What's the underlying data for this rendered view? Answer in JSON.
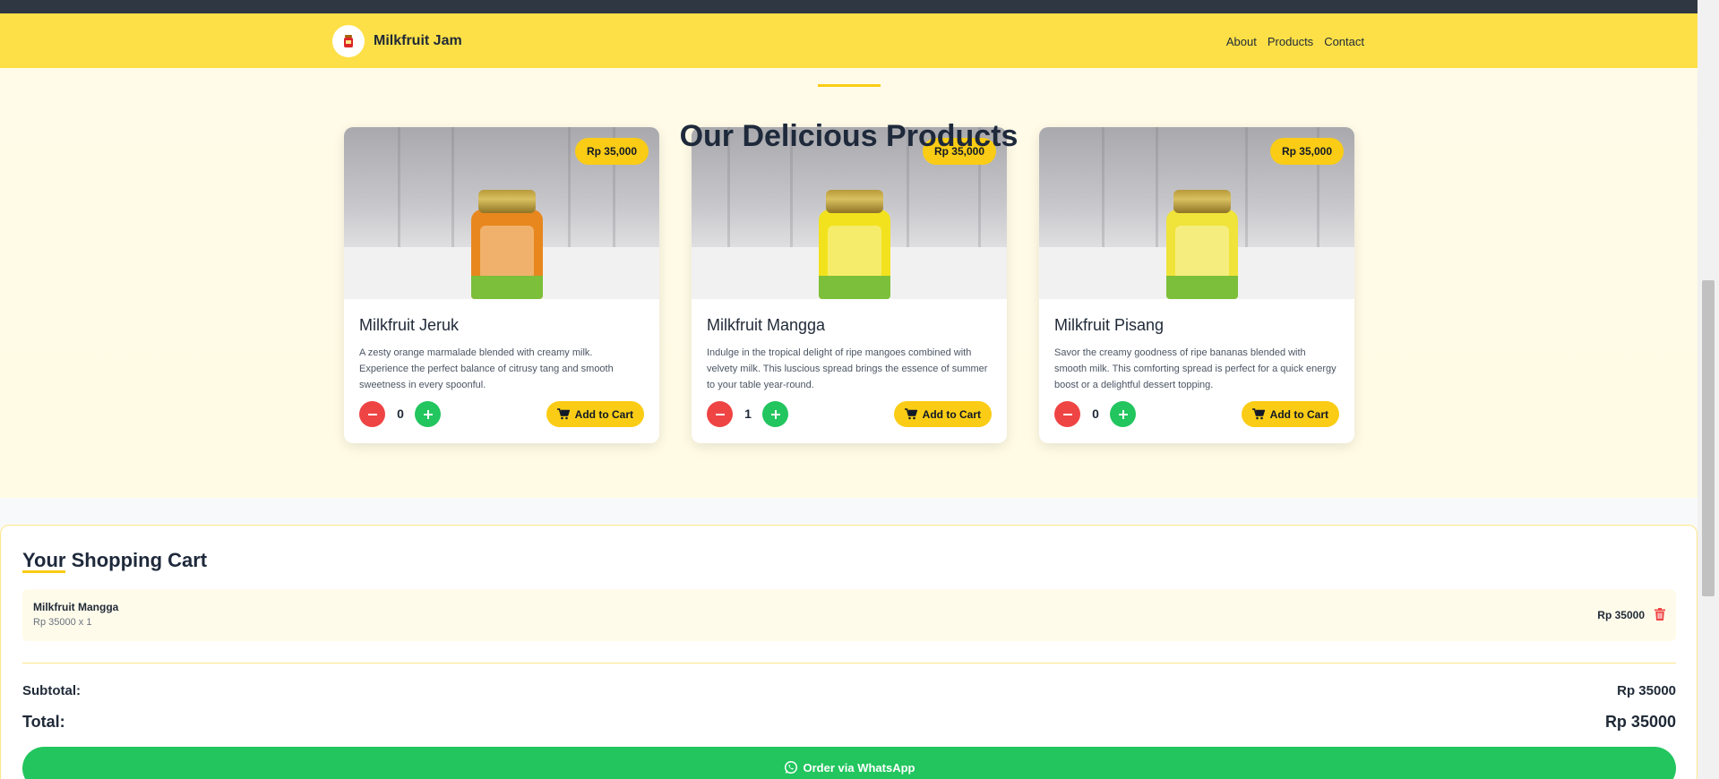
{
  "nav": {
    "brand": "Milkfruit Jam",
    "links": [
      "About",
      "Products",
      "Contact"
    ]
  },
  "products_section": {
    "title": "Our Delicious Products"
  },
  "products": [
    {
      "name": "Milkfruit Jeruk",
      "price": "Rp 35,000",
      "description": "A zesty orange marmalade blended with creamy milk. Experience the perfect balance of citrusy tang and smooth sweetness in every spoonful.",
      "quantity": "0",
      "add_label": "Add to Cart",
      "jar_color": "#e8871e"
    },
    {
      "name": "Milkfruit Mangga",
      "price": "Rp 35,000",
      "description": "Indulge in the tropical delight of ripe mangoes combined with velvety milk. This luscious spread brings the essence of summer to your table year-round.",
      "quantity": "1",
      "add_label": "Add to Cart",
      "jar_color": "#f2e21d"
    },
    {
      "name": "Milkfruit Pisang",
      "price": "Rp 35,000",
      "description": "Savor the creamy goodness of ripe bananas blended with smooth milk. This comforting spread is perfect for a quick energy boost or a delightful dessert topping.",
      "quantity": "0",
      "add_label": "Add to Cart",
      "jar_color": "#f0e33a"
    }
  ],
  "cart": {
    "title": "Your Shopping Cart",
    "items": [
      {
        "name": "Milkfruit Mangga",
        "detail": "Rp 35000 x 1",
        "total": "Rp 35000"
      }
    ],
    "subtotal_label": "Subtotal:",
    "subtotal_value": "Rp 35000",
    "total_label": "Total:",
    "total_value": "Rp 35000",
    "order_label": "Order via WhatsApp"
  },
  "colors": {
    "nav_bg": "#fde047",
    "accent": "#facc15",
    "minus": "#ef4444",
    "plus": "#22c55e",
    "whatsapp": "#22c55e"
  }
}
